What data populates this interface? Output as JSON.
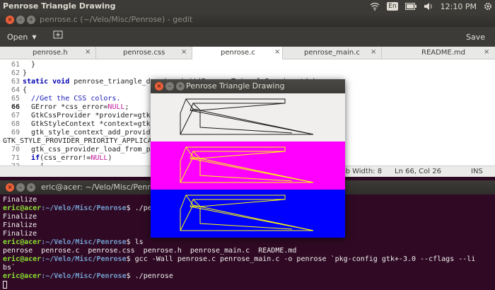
{
  "top_panel": {
    "title": "Penrose Triangle Drawing",
    "keyboard": "En",
    "clock": "12:10 PM",
    "icons": [
      "wifi-icon",
      "keyboard-layout-icon",
      "battery-icon",
      "volume-icon",
      "system-gear-icon"
    ]
  },
  "gedit": {
    "title": "penrose.c (~/Velo/Misc/Penrose) - gedit",
    "open_label": "Open",
    "save_label": "Save",
    "tabs": [
      {
        "label": "penrose.h",
        "close": "×"
      },
      {
        "label": "penrose.css",
        "close": "×"
      },
      {
        "label": "penrose.c",
        "close": "×"
      },
      {
        "label": "penrose_main.c",
        "close": "×"
      },
      {
        "label": "README.md",
        "close": "×"
      }
    ],
    "lines": [
      {
        "n": "61",
        "pre": "  }",
        "kw": "",
        "post": ""
      },
      {
        "n": "62",
        "pre": "}",
        "kw": "",
        "post": ""
      },
      {
        "n": "63",
        "pre": "",
        "kw": "static void",
        "post": " penrose_triangle_drawing_init(PenroseTriangleDrawing *da)"
      },
      {
        "n": "64",
        "pre": "{",
        "kw": "",
        "post": ""
      },
      {
        "n": "65",
        "pre": "  ",
        "cmt": "//Get the CSS colors.",
        "kw": "",
        "post": ""
      },
      {
        "n": "66",
        "pre": "  GError *css_error=",
        "nul": "NULL",
        "post2": ";",
        "kw": "",
        "post": ""
      },
      {
        "n": "67",
        "pre": "  GtkCssProvider *provider=gtk_css_provider_new();",
        "kw": "",
        "post": ""
      },
      {
        "n": "68",
        "pre": "  GtkStyleContext *context=gtk_widget_get_style_context(GTK_WIDGET(da));",
        "kw": "",
        "post": ""
      },
      {
        "n": "69",
        "pre": "  gtk_style_context_add_provider(context, GTK_STYLE_PROVIDER(provider),",
        "kw": "",
        "post": ""
      },
      {
        "n": "",
        "pre": "GTK_STYLE_PROVIDER_PRIORITY_APPLICATION);",
        "kw": "",
        "post": ""
      },
      {
        "n": "70",
        "pre": "  gtk_css_provider_load_from_path(provider, \"penrose.css\", &css_error);",
        "kw": "",
        "post": ""
      },
      {
        "n": "71",
        "pre": "  ",
        "kw": "if",
        "post": "(css_error!=",
        "nul": "NULL",
        "post2": ")"
      },
      {
        "n": "72",
        "pre": "    {",
        "kw": "",
        "post": ""
      }
    ],
    "status": {
      "tab_width": "Tab Width: 8",
      "position": "Ln 66, Col 26",
      "mode": "INS"
    }
  },
  "terminal": {
    "title": "eric@acer: ~/Velo/Misc/Penrose",
    "lines": [
      {
        "type": "out",
        "text": "Finalize"
      },
      {
        "type": "prompt",
        "user": "eric@acer",
        "path": ":~/Velo/Misc/Penrose",
        "cmd": "$ ./penrose"
      },
      {
        "type": "out",
        "text": "Finalize"
      },
      {
        "type": "out",
        "text": "Finalize"
      },
      {
        "type": "out",
        "text": "Finalize"
      },
      {
        "type": "prompt",
        "user": "eric@acer",
        "path": ":~/Velo/Misc/Penrose",
        "cmd": "$ ls"
      },
      {
        "type": "out",
        "text": "penrose  penrose.c  penrose.css  penrose.h  penrose_main.c  README.md"
      },
      {
        "type": "prompt",
        "user": "eric@acer",
        "path": ":~/Velo/Misc/Penrose",
        "cmd": "$ gcc -Wall penrose.c penrose_main.c -o penrose `pkg-config gtk+-3.0 --cflags --li"
      },
      {
        "type": "out",
        "text": "bs`"
      },
      {
        "type": "prompt",
        "user": "eric@acer",
        "path": ":~/Velo/Misc/Penrose",
        "cmd": "$ ./penrose"
      }
    ]
  },
  "penrose_window": {
    "title": "Penrose Triangle Drawing",
    "bands": [
      {
        "bg": "#f0efee",
        "stroke": "#1a1a1a"
      },
      {
        "bg": "#ff00ff",
        "stroke": "#ffff00"
      },
      {
        "bg": "#0000ff",
        "stroke": "#ffff00"
      }
    ]
  }
}
